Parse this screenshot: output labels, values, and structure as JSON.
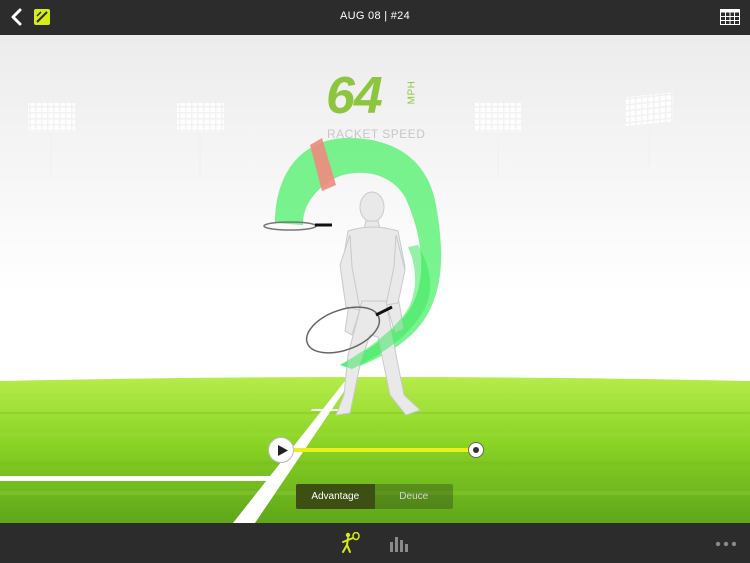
{
  "header": {
    "title": "AUG 08 | #24"
  },
  "metric": {
    "value": "64",
    "unit": "MPH",
    "label": "RACKET SPEED"
  },
  "view_toggle": {
    "options": [
      {
        "label": "Advantage",
        "selected": true
      },
      {
        "label": "Deuce",
        "selected": false
      }
    ]
  },
  "playback": {
    "progress": 1.0
  },
  "colors": {
    "accent": "#d5ec16",
    "speed_green": "#8cc63f",
    "swing_path": "#4cf06a",
    "peak_zone": "#ef8a80",
    "court": "#6fc020"
  },
  "icons": {
    "back": "chevron-left-icon",
    "logo": "app-logo-icon",
    "grid": "grid-icon",
    "swing_tab": "tennis-player-icon",
    "stats_tab": "bar-chart-icon",
    "more": "more-dots-icon"
  }
}
